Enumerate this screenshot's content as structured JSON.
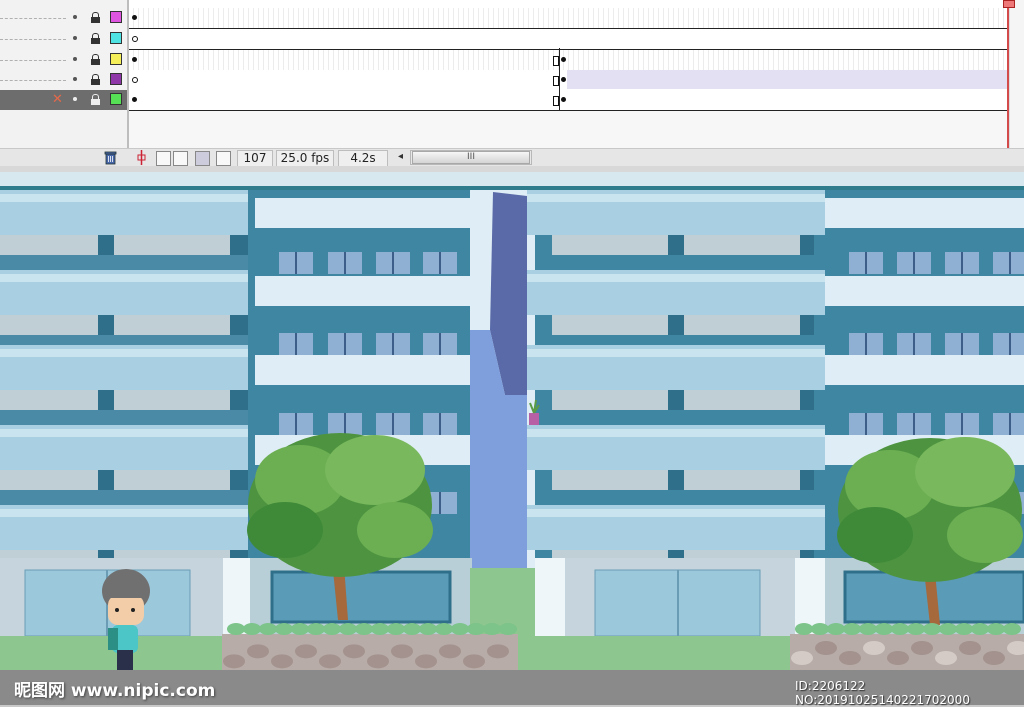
{
  "layers": [
    {
      "color": "#e055e0",
      "selected": false,
      "locked": true
    },
    {
      "color": "#4fe3e3",
      "selected": false,
      "locked": true
    },
    {
      "color": "#f5f05a",
      "selected": false,
      "locked": true
    },
    {
      "color": "#8f37a8",
      "selected": false,
      "locked": true
    },
    {
      "color": "#55e055",
      "selected": true,
      "locked": false
    }
  ],
  "statusbar": {
    "frame": "107",
    "fps": "25.0 fps",
    "time": "4.2s",
    "scroll_grip": "III"
  },
  "watermark": {
    "site": "昵图网 www.nipic.com",
    "id_text": "ID:2206122 NO:20191025140221702000"
  },
  "colors": {
    "playhead": "#d34b4b",
    "building_light": "#a9d0e2",
    "building_dark": "#3b7d98",
    "tree": "#5b9e45",
    "ground": "#8ec68f"
  }
}
